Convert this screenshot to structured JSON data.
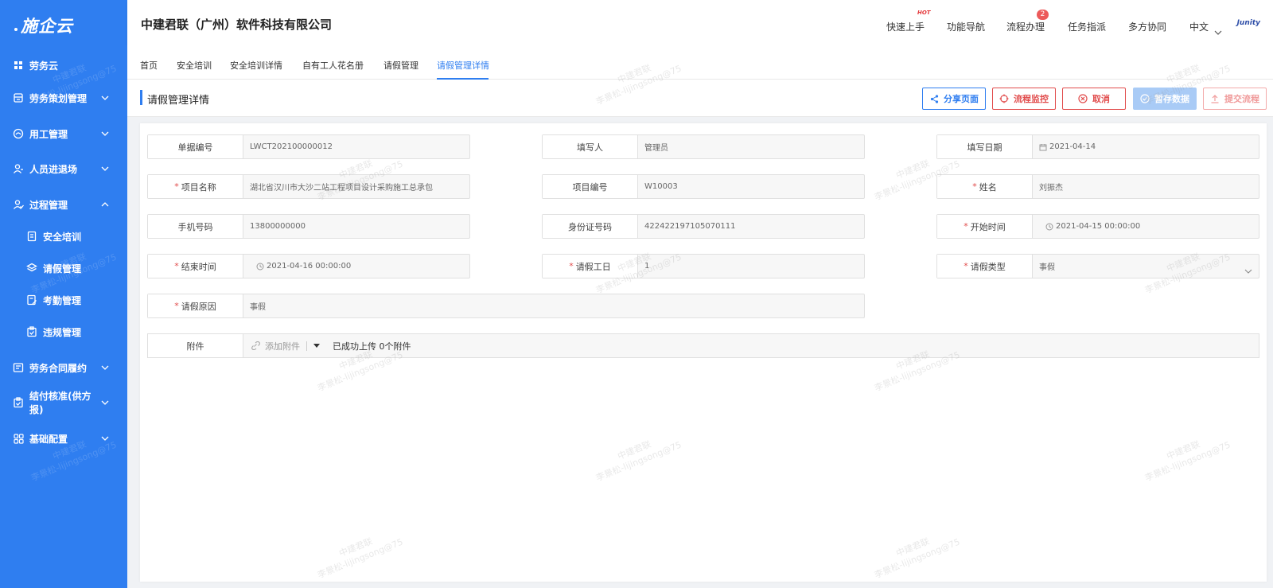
{
  "app": {
    "logo": "施企云",
    "company": "中建君联（广州）软件科技有限公司",
    "brand": "Junity"
  },
  "header": {
    "nav": [
      "快速上手",
      "功能导航",
      "流程办理",
      "任务指派",
      "多方协同",
      "中文"
    ],
    "hot_label": "HOT",
    "badge": "2"
  },
  "sidebar": {
    "items": [
      {
        "label": "劳务云",
        "icon": "grid-icon"
      },
      {
        "label": "劳务策划管理",
        "icon": "stack-icon"
      },
      {
        "label": "用工管理",
        "icon": "worker-icon"
      },
      {
        "label": "人员进退场",
        "icon": "user-icon"
      },
      {
        "label": "过程管理",
        "icon": "user-check-icon"
      },
      {
        "label": "安全培训",
        "icon": "doc-icon"
      },
      {
        "label": "请假管理",
        "icon": "layers-icon"
      },
      {
        "label": "考勤管理",
        "icon": "doc-edit-icon"
      },
      {
        "label": "违规管理",
        "icon": "clipboard-icon"
      },
      {
        "label": "劳务合同履约",
        "icon": "contract-icon"
      },
      {
        "label": "结付核准(供方报)",
        "icon": "clipboard-check-icon"
      },
      {
        "label": "基础配置",
        "icon": "apps-icon"
      }
    ]
  },
  "tabs": [
    "首页",
    "安全培训",
    "安全培训详情",
    "自有工人花名册",
    "请假管理",
    "请假管理详情"
  ],
  "page": {
    "title": "请假管理详情",
    "buttons": [
      "分享页面",
      "流程监控",
      "取消",
      "暂存数据",
      "提交流程"
    ]
  },
  "form": {
    "doc_no": {
      "label": "单据编号",
      "value": "LWCT202100000012"
    },
    "writer": {
      "label": "填写人",
      "value": "管理员"
    },
    "date": {
      "label": "填写日期",
      "value": "2021-04-14"
    },
    "project_name": {
      "label": "项目名称",
      "value": "湖北省汉川市大沙二站工程项目设计采购施工总承包"
    },
    "project_no": {
      "label": "项目编号",
      "value": "W10003"
    },
    "name": {
      "label": "姓名",
      "value": "刘振杰"
    },
    "phone": {
      "label": "手机号码",
      "value": "13800000000"
    },
    "id_no": {
      "label": "身份证号码",
      "value": "422422197105070111"
    },
    "start": {
      "label": "开始时间",
      "value": "2021-04-15 00:00:00"
    },
    "end": {
      "label": "结束时间",
      "value": "2021-04-16 00:00:00"
    },
    "days": {
      "label": "请假工日",
      "value": "1"
    },
    "type": {
      "label": "请假类型",
      "value": "事假"
    },
    "reason": {
      "label": "请假原因",
      "value": "事假"
    },
    "attachment": {
      "label": "附件",
      "add_label": "添加附件",
      "status": "已成功上传 0个附件"
    }
  },
  "watermark": {
    "line1": "中建君联",
    "line2": "李景松-lijingsong@75"
  },
  "colors": {
    "primary": "#2f7ef0",
    "danger": "#e14c4c"
  }
}
